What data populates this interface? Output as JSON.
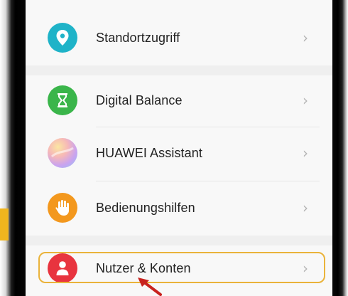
{
  "menu": {
    "items": [
      {
        "label": "Standortzugriff",
        "icon": "location-pin-icon",
        "icon_color": "#1fb3c8"
      },
      {
        "label": "Digital Balance",
        "icon": "hourglass-icon",
        "icon_color": "#3ab54a"
      },
      {
        "label": "HUAWEI Assistant",
        "icon": "assistant-gradient-icon",
        "icon_color": "#e9a6c9"
      },
      {
        "label": "Bedienungshilfen",
        "icon": "hand-icon",
        "icon_color": "#f3981e"
      },
      {
        "label": "Nutzer & Konten",
        "icon": "user-icon",
        "icon_color": "#e8343f"
      }
    ],
    "chevron": "›"
  },
  "annotation": {
    "highlight_color": "#eab33a",
    "arrow_color": "#c8231f",
    "side_tab_color": "#f0b51e"
  }
}
